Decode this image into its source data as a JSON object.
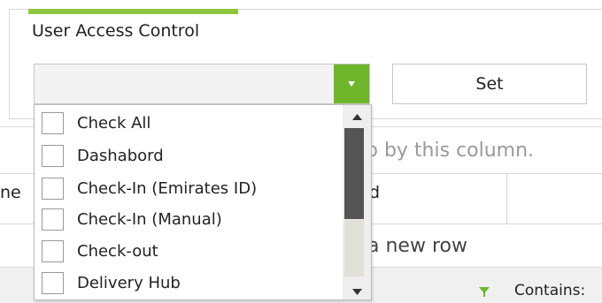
{
  "panel": {
    "title": "User Access Control",
    "accent_color": "#8cc63f",
    "combo_button_color": "#6fb52c",
    "combo_button_icon": "chevron-down-icon",
    "set_label": "Set"
  },
  "dropdown": {
    "items": [
      {
        "label": "Check All",
        "checked": false
      },
      {
        "label": "Dashabord",
        "checked": false
      },
      {
        "label": "Check-In (Emirates ID)",
        "checked": false
      },
      {
        "label": "Check-In (Manual)",
        "checked": false
      },
      {
        "label": "Check-out",
        "checked": false
      },
      {
        "label": "Delivery Hub",
        "checked": false
      }
    ],
    "scroll_up_icon": "caret-up-icon",
    "scroll_down_icon": "caret-down-icon"
  },
  "grid": {
    "group_hint": "p by this column.",
    "col_header_name": "ne",
    "col_header_id": "d",
    "new_row_hint": "a new row",
    "filter_icon": "filter-icon",
    "filter_operator": "Contains:"
  }
}
